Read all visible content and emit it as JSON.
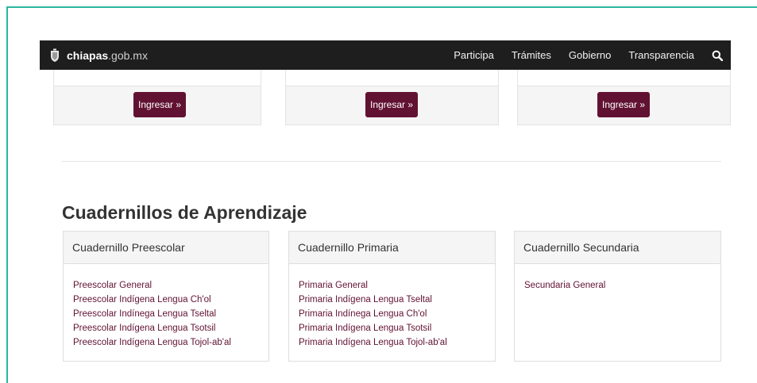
{
  "navbar": {
    "brand_bold": "chiapas",
    "brand_domain": ".gob.mx",
    "links": [
      "Participa",
      "Trámites",
      "Gobierno",
      "Transparencia"
    ]
  },
  "cards": {
    "button_label": "Ingresar »"
  },
  "section": {
    "title": "Cuadernillos de Aprendizaje"
  },
  "panels": [
    {
      "title": "Cuadernillo Preescolar",
      "links": [
        "Preescolar General",
        "Preescolar Indígena Lengua Ch'ol",
        "Preescolar Indínega Lengua Tseltal",
        "Preescolar Indígena Lengua Tsotsil",
        "Preescolar Indígena Lengua Tojol-ab'al"
      ]
    },
    {
      "title": "Cuadernillo Primaria",
      "links": [
        "Primaria General",
        "Primaria Indígena Lengua Tseltal",
        "Primaria Indínega Lengua Ch'ol",
        "Primaria Indígena Lengua Tsotsil",
        "Primaria Indígena Lengua Tojol-ab'al"
      ]
    },
    {
      "title": "Cuadernillo Secundaria",
      "links": [
        "Secundaria General"
      ]
    }
  ],
  "colors": {
    "accent": "#611232",
    "navbar": "#1e1e1e",
    "frame": "#2bb5a0"
  },
  "icons": {
    "brand": "coat-of-arms-icon",
    "search": "search-icon"
  }
}
